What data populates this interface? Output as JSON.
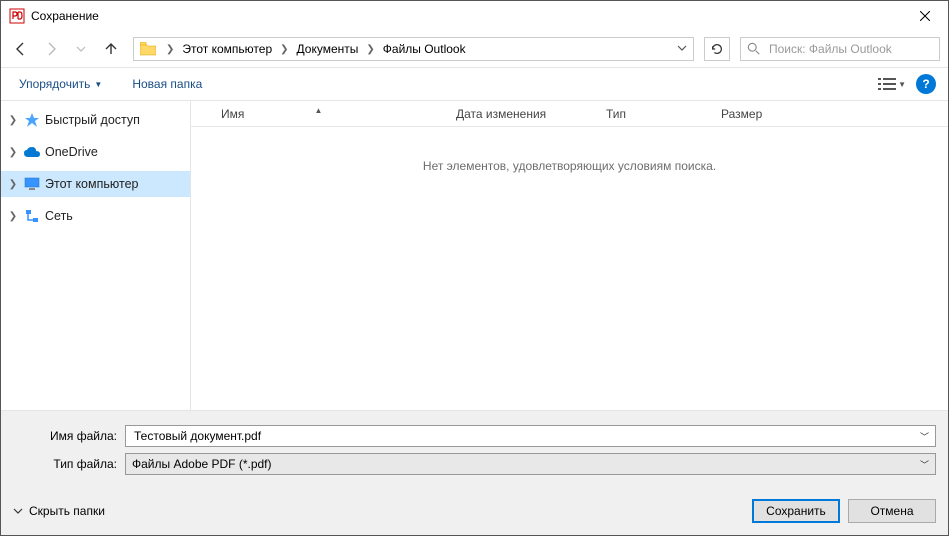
{
  "title": "Сохранение",
  "breadcrumb": [
    "Этот компьютер",
    "Документы",
    "Файлы Outlook"
  ],
  "search_placeholder": "Поиск: Файлы Outlook",
  "toolbar": {
    "organize": "Упорядочить",
    "new_folder": "Новая папка"
  },
  "tree": [
    {
      "label": "Быстрый доступ",
      "selected": false,
      "icon": "star"
    },
    {
      "label": "OneDrive",
      "selected": false,
      "icon": "cloud"
    },
    {
      "label": "Этот компьютер",
      "selected": true,
      "icon": "monitor"
    },
    {
      "label": "Сеть",
      "selected": false,
      "icon": "network"
    }
  ],
  "columns": {
    "name": "Имя",
    "date": "Дата изменения",
    "type": "Тип",
    "size": "Размер"
  },
  "empty_message": "Нет элементов, удовлетворяющих условиям поиска.",
  "filename_label": "Имя файла:",
  "filename_value": "Тестовый документ.pdf",
  "filetype_label": "Тип файла:",
  "filetype_value": "Файлы Adobe PDF (*.pdf)",
  "hide_folders": "Скрыть папки",
  "save_btn": "Сохранить",
  "cancel_btn": "Отмена"
}
